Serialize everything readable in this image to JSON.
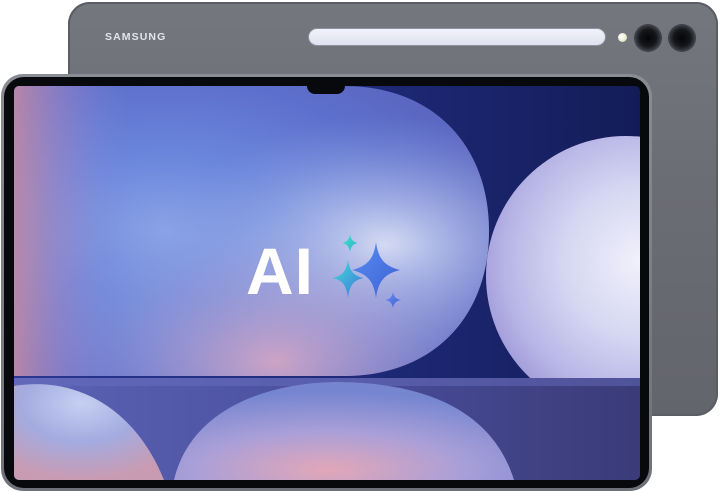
{
  "product": {
    "brand": "SAMSUNG"
  },
  "screen": {
    "headline": "AI",
    "sparkle_icon": "ai-sparkle-icon"
  },
  "colors": {
    "device_body": "#6c6f75",
    "screen_blue": "#4f6fd0",
    "screen_navy": "#1b2568",
    "sparkle_teal": "#3fd6c9",
    "sparkle_blue": "#4a78e8"
  }
}
